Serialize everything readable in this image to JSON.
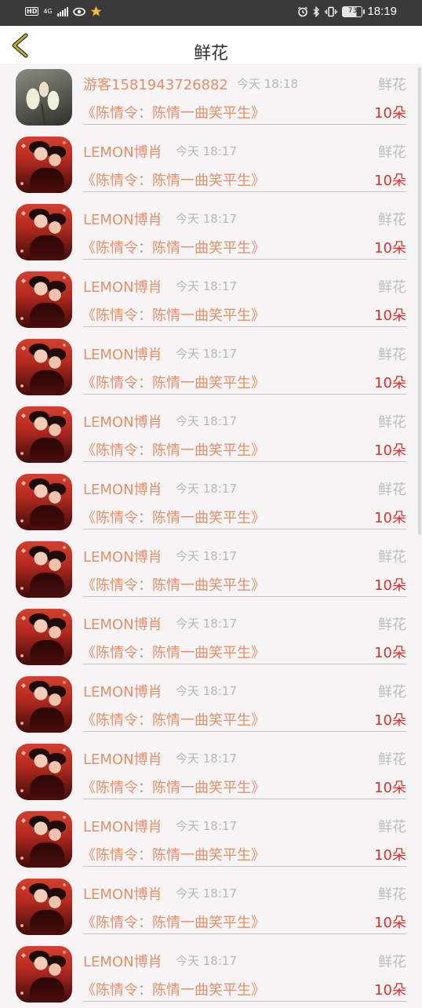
{
  "status_bar": {
    "hd": "HD",
    "network": "4G",
    "battery": "73",
    "time": "18:19",
    "icons": [
      "hd-icon",
      "signal-icon",
      "eye-icon",
      "star-icon",
      "alarm-icon",
      "bluetooth-icon",
      "vibrate-icon",
      "battery-icon"
    ]
  },
  "header": {
    "title": "鲜花",
    "back_icon": "chevron-left-icon",
    "accent_color": "#c8b32a"
  },
  "colors": {
    "name": "#e2906a",
    "time": "#b7b7b7",
    "count": "#d0352e",
    "gift": "#bdbdbd"
  },
  "list": {
    "items": [
      {
        "avatar": "magnolia-flower",
        "name": "游客1581943726882",
        "time": "今天 18:18",
        "gift": "鲜花",
        "work": "《陈情令：陈情一曲笑平生》",
        "count": "10朵"
      },
      {
        "avatar": "lemon-couple",
        "name": "LEMON博肖",
        "time": "今天 18:17",
        "gift": "鲜花",
        "work": "《陈情令：陈情一曲笑平生》",
        "count": "10朵"
      },
      {
        "avatar": "lemon-couple",
        "name": "LEMON博肖",
        "time": "今天 18:17",
        "gift": "鲜花",
        "work": "《陈情令：陈情一曲笑平生》",
        "count": "10朵"
      },
      {
        "avatar": "lemon-couple",
        "name": "LEMON博肖",
        "time": "今天 18:17",
        "gift": "鲜花",
        "work": "《陈情令：陈情一曲笑平生》",
        "count": "10朵"
      },
      {
        "avatar": "lemon-couple",
        "name": "LEMON博肖",
        "time": "今天 18:17",
        "gift": "鲜花",
        "work": "《陈情令：陈情一曲笑平生》",
        "count": "10朵"
      },
      {
        "avatar": "lemon-couple",
        "name": "LEMON博肖",
        "time": "今天 18:17",
        "gift": "鲜花",
        "work": "《陈情令：陈情一曲笑平生》",
        "count": "10朵"
      },
      {
        "avatar": "lemon-couple",
        "name": "LEMON博肖",
        "time": "今天 18:17",
        "gift": "鲜花",
        "work": "《陈情令：陈情一曲笑平生》",
        "count": "10朵"
      },
      {
        "avatar": "lemon-couple",
        "name": "LEMON博肖",
        "time": "今天 18:17",
        "gift": "鲜花",
        "work": "《陈情令：陈情一曲笑平生》",
        "count": "10朵"
      },
      {
        "avatar": "lemon-couple",
        "name": "LEMON博肖",
        "time": "今天 18:17",
        "gift": "鲜花",
        "work": "《陈情令：陈情一曲笑平生》",
        "count": "10朵"
      },
      {
        "avatar": "lemon-couple",
        "name": "LEMON博肖",
        "time": "今天 18:17",
        "gift": "鲜花",
        "work": "《陈情令：陈情一曲笑平生》",
        "count": "10朵"
      },
      {
        "avatar": "lemon-couple",
        "name": "LEMON博肖",
        "time": "今天 18:17",
        "gift": "鲜花",
        "work": "《陈情令：陈情一曲笑平生》",
        "count": "10朵"
      },
      {
        "avatar": "lemon-couple",
        "name": "LEMON博肖",
        "time": "今天 18:17",
        "gift": "鲜花",
        "work": "《陈情令：陈情一曲笑平生》",
        "count": "10朵"
      },
      {
        "avatar": "lemon-couple",
        "name": "LEMON博肖",
        "time": "今天 18:17",
        "gift": "鲜花",
        "work": "《陈情令：陈情一曲笑平生》",
        "count": "10朵"
      },
      {
        "avatar": "lemon-couple",
        "name": "LEMON博肖",
        "time": "今天 18:17",
        "gift": "鲜花",
        "work": "《陈情令：陈情一曲笑平生》",
        "count": "10朵"
      }
    ]
  }
}
